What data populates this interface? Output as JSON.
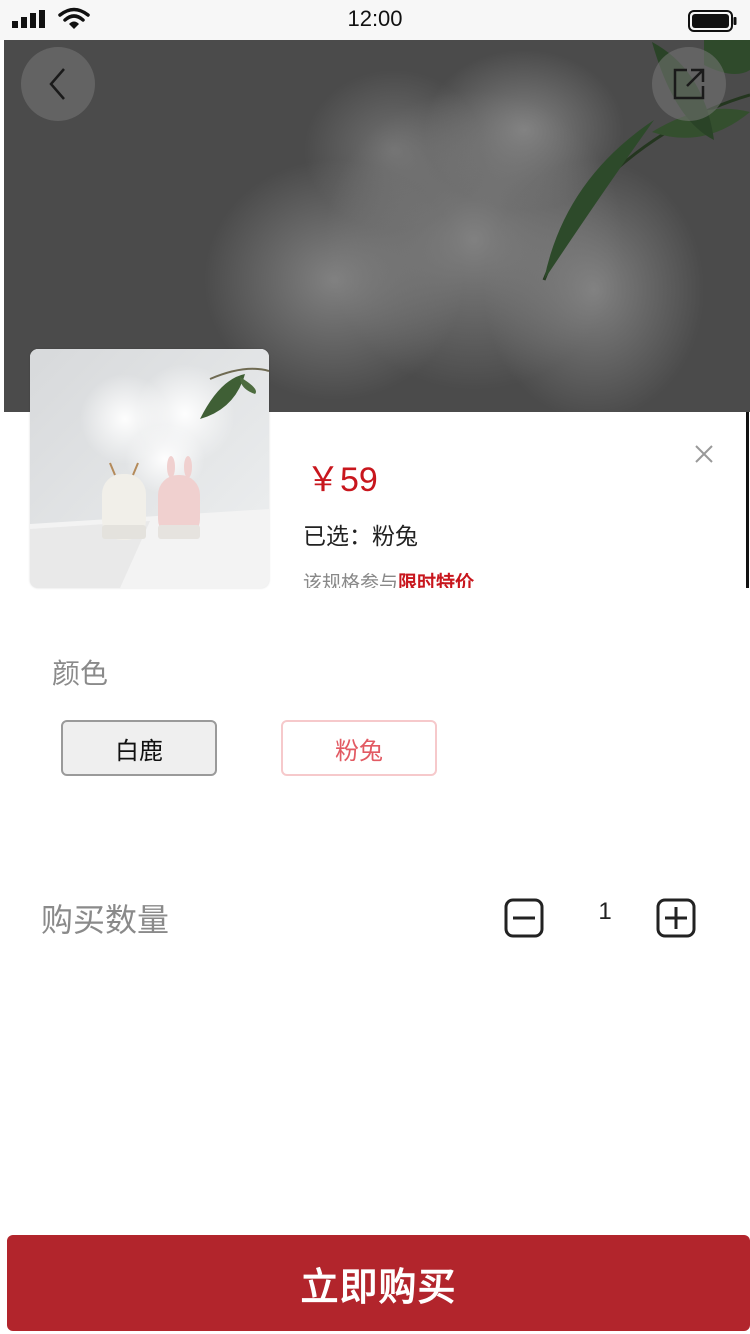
{
  "status_bar": {
    "time": "12:00"
  },
  "hero": {
    "back_icon": "chevron-left-icon",
    "share_icon": "share-external-icon"
  },
  "product": {
    "price": "￥59",
    "selected": "已选：粉兔",
    "promo_prefix": "该规格参与",
    "promo_highlight": "限时特价",
    "close_icon": "close-icon"
  },
  "options": {
    "label": "颜色",
    "items": [
      {
        "label": "白鹿",
        "selected": false
      },
      {
        "label": "粉兔",
        "selected": true
      }
    ]
  },
  "quantity": {
    "label": "购买数量",
    "value": "1",
    "minus_icon": "minus-square-icon",
    "plus_icon": "plus-square-icon"
  },
  "buy_button": {
    "label": "立即购买"
  },
  "colors": {
    "accent": "#c8161d",
    "buy_bg": "#b2252c",
    "pink_border": "#f6c9cb",
    "pink_text": "#e25a63"
  }
}
